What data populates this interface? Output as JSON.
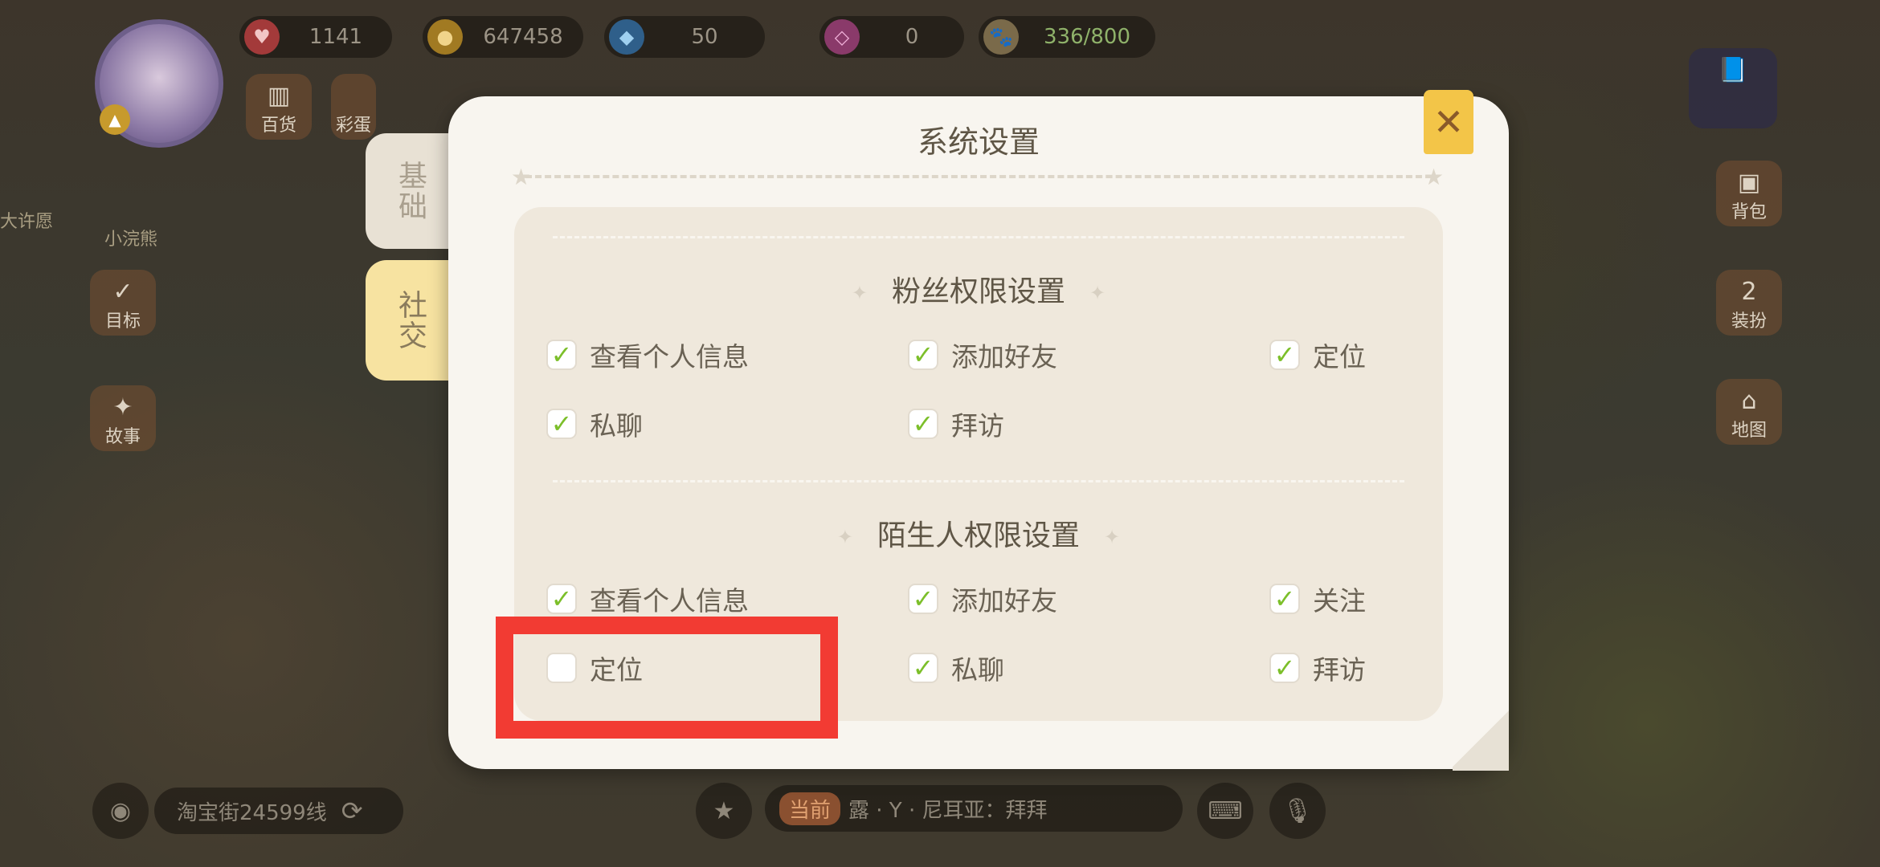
{
  "resources": [
    {
      "icon": "heart-icon",
      "value": "1141"
    },
    {
      "icon": "coin-icon",
      "value": "647458"
    },
    {
      "icon": "diamond-icon",
      "value": "50"
    },
    {
      "icon": "gem-icon",
      "value": "0"
    },
    {
      "icon": "energy-icon",
      "value": "336/800"
    }
  ],
  "left_menu": {
    "store": "百货",
    "lottery": "彩蛋",
    "goal": "目标",
    "story": "故事",
    "wish": "大许愿",
    "npc_name": "小浣熊"
  },
  "right_menu": {
    "bag": "背包",
    "dressup": "装扮",
    "dressup_badge": "2",
    "map": "地图"
  },
  "dialog": {
    "title": "系统设置",
    "close": "✕",
    "tabs": [
      {
        "label": "基础",
        "active": false
      },
      {
        "label": "社交",
        "active": true
      }
    ],
    "sections": [
      {
        "title": "粉丝权限设置",
        "options": [
          {
            "label": "查看个人信息",
            "checked": true
          },
          {
            "label": "添加好友",
            "checked": true
          },
          {
            "label": "定位",
            "checked": true
          },
          {
            "label": "私聊",
            "checked": true
          },
          {
            "label": "拜访",
            "checked": true
          }
        ]
      },
      {
        "title": "陌生人权限设置",
        "options": [
          {
            "label": "查看个人信息",
            "checked": true
          },
          {
            "label": "添加好友",
            "checked": true
          },
          {
            "label": "关注",
            "checked": true
          },
          {
            "label": "定位",
            "checked": false
          },
          {
            "label": "私聊",
            "checked": true
          },
          {
            "label": "拜访",
            "checked": true
          }
        ]
      }
    ]
  },
  "bottom": {
    "server": "淘宝街24599线",
    "chat_channel": "当前",
    "chat_message": "露 · Y · 尼耳亚：拜拜"
  },
  "colors": {
    "check": "#7cbf2a",
    "highlight": "#f23b33",
    "tab_active": "#f7e3a1",
    "close": "#f3c548"
  }
}
